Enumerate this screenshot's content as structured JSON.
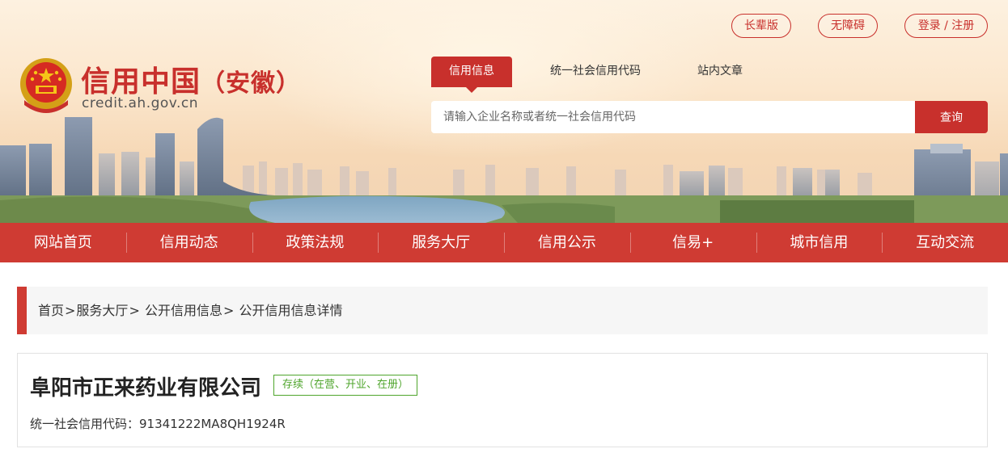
{
  "top_links": {
    "elder": "长辈版",
    "accessible": "无障碍",
    "login": "登录 / 注册"
  },
  "logo": {
    "title_main": "信用中国",
    "title_province": "（安徽）",
    "domain": "credit.ah.gov.cn"
  },
  "search": {
    "tabs": [
      {
        "label": "信用信息",
        "active": true
      },
      {
        "label": "统一社会信用代码",
        "active": false
      },
      {
        "label": "站内文章",
        "active": false
      }
    ],
    "placeholder": "请输入企业名称或者统一社会信用代码",
    "button_label": "查询"
  },
  "nav": {
    "items": [
      "网站首页",
      "信用动态",
      "政策法规",
      "服务大厅",
      "信用公示",
      "信易+",
      "城市信用",
      "互动交流"
    ]
  },
  "breadcrumb": {
    "items": [
      "首页",
      "服务大厅",
      "公开信用信息",
      "公开信用信息详情"
    ],
    "separator": ">"
  },
  "company": {
    "name": "阜阳市正来药业有限公司",
    "status": "存续（在营、开业、在册）",
    "credit_code_label": "统一社会信用代码：",
    "credit_code": "91341222MA8QH1924R"
  },
  "colors": {
    "brand_red": "#c8302c",
    "nav_red": "#cf3b33",
    "status_green": "#4fa52c"
  }
}
